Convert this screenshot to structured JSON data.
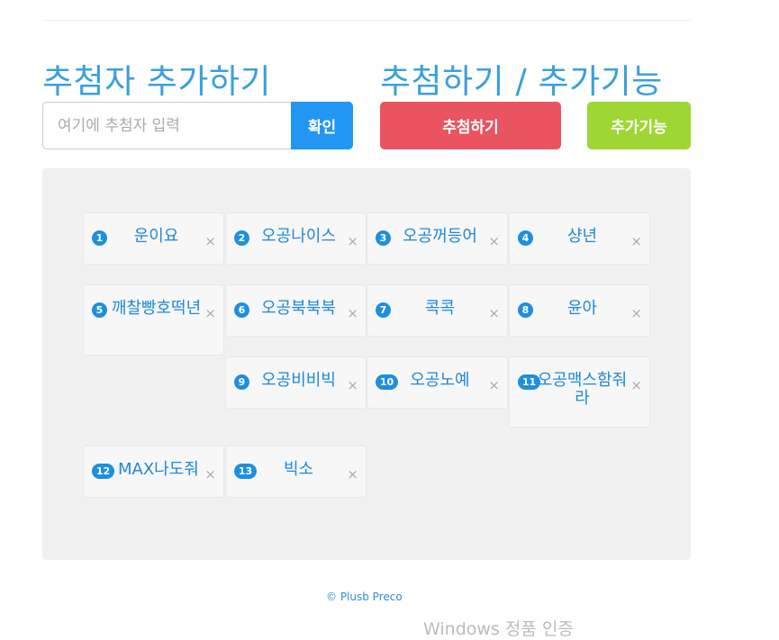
{
  "header": {
    "add_title": "추첨자 추가하기",
    "draw_title": "추첨하기 / 추가기능"
  },
  "form": {
    "placeholder": "여기에 추첨자 입력",
    "confirm_label": "확인"
  },
  "buttons": {
    "draw_label": "추첨하기",
    "extra_label": "추가기능"
  },
  "entries": [
    {
      "num": "1",
      "name": "운이요"
    },
    {
      "num": "2",
      "name": "오공나이스"
    },
    {
      "num": "3",
      "name": "오공꺼등어"
    },
    {
      "num": "4",
      "name": "샹년"
    },
    {
      "num": "5",
      "name": "깨찰빵호떡년"
    },
    {
      "num": "6",
      "name": "오공북북북"
    },
    {
      "num": "7",
      "name": "콕콕"
    },
    {
      "num": "8",
      "name": "윤아"
    },
    {
      "num": "9",
      "name": "오공비비빅"
    },
    {
      "num": "10",
      "name": "오공노예"
    },
    {
      "num": "11",
      "name": "오공맥스함줘라"
    },
    {
      "num": "12",
      "name": "MAX나도줘"
    },
    {
      "num": "13",
      "name": "빅소"
    }
  ],
  "close_glyph": "×",
  "footer": {
    "copyright": "© Plusb Preco"
  },
  "os_watermark": "Windows 정품 인증",
  "colors": {
    "heading": "#3aa0dd",
    "confirm": "#2196f3",
    "draw": "#ea5460",
    "extra": "#9ed634",
    "badge": "#1e8fe0",
    "panel": "#f0f0f0"
  }
}
